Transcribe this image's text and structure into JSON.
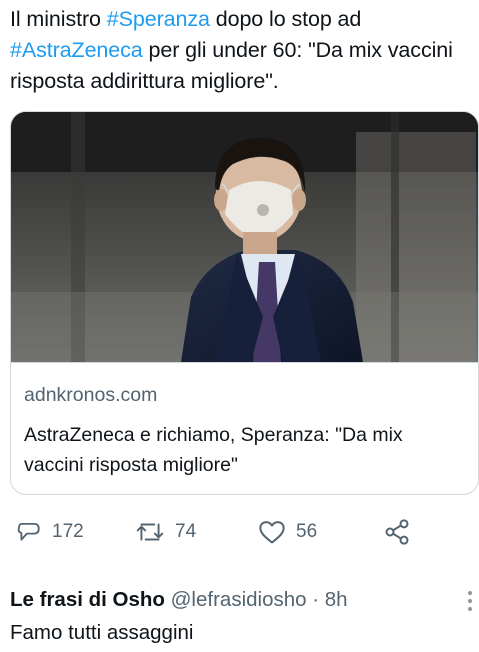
{
  "tweet": {
    "text_1": "Il ministro ",
    "hashtag_1": "#Speranza",
    "text_2": " dopo lo stop ad ",
    "hashtag_2": "#AstraZeneca",
    "text_3": " per gli under 60: \"Da mix vaccini risposta addirittura migliore\"."
  },
  "card": {
    "domain": "adnkronos.com",
    "title": "AstraZeneca e richiamo, Speranza: \"Da mix vaccini risposta migliore\""
  },
  "actions": {
    "replies": "172",
    "retweets": "74",
    "likes": "56"
  },
  "reply": {
    "name": "Le frasi di Osho",
    "handle": "@lefrasidiosho",
    "separator": "·",
    "time": "8h",
    "text": "Famo tutti assaggini"
  },
  "icons": {
    "reply": "reply-bubble-icon",
    "retweet": "retweet-icon",
    "like": "heart-icon",
    "share": "share-icon",
    "more": "vertical-dots-icon"
  },
  "colors": {
    "hashtag": "#1d9bf0",
    "text": "#0f1419",
    "secondary": "#536471",
    "border": "#cfd9de"
  }
}
